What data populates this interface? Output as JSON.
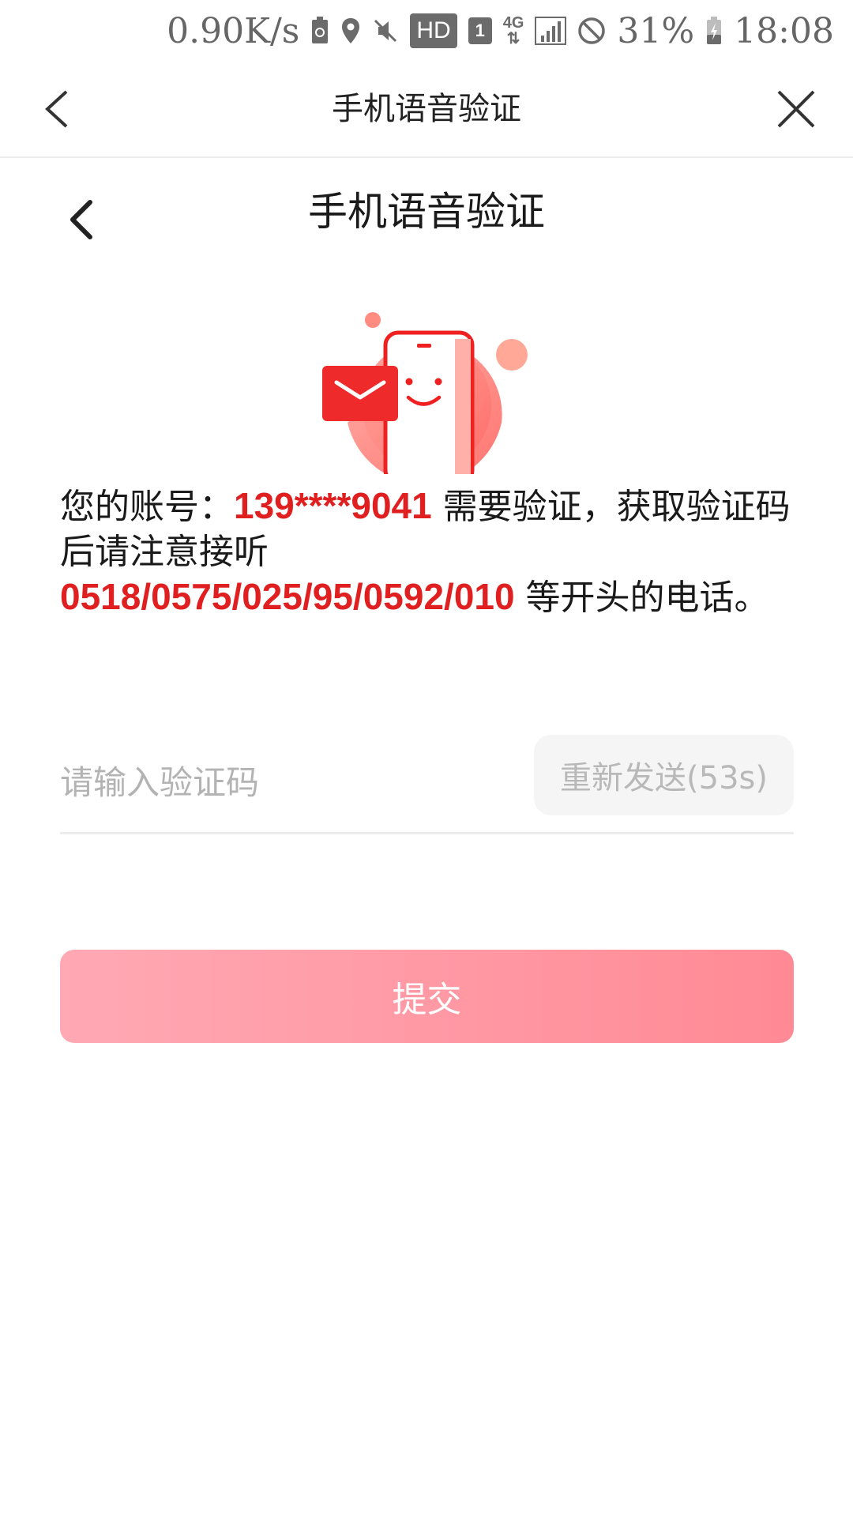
{
  "status_bar": {
    "net_speed": "0.90K/s",
    "hd_label": "HD",
    "sim_label": "1",
    "network_label": "4G",
    "battery_percent": "31%",
    "time": "18:08"
  },
  "top_nav": {
    "title": "手机语音验证"
  },
  "page": {
    "title": "手机语音验证"
  },
  "message": {
    "prefix": "您的账号：",
    "account": "139****9041",
    "middle": " 需要验证，获取验证码后请注意接听",
    "phone_prefixes": "0518/0575/025/95/0592/010",
    "suffix": " 等开头的电话。"
  },
  "code_input": {
    "placeholder": "请输入验证码",
    "value": ""
  },
  "resend_button": {
    "label": "重新发送(53s)"
  },
  "submit_button": {
    "label": "提交"
  },
  "colors": {
    "accent": "#e02020",
    "submit_gradient_start": "#ffa9b4",
    "submit_gradient_end": "#ff8a95"
  }
}
